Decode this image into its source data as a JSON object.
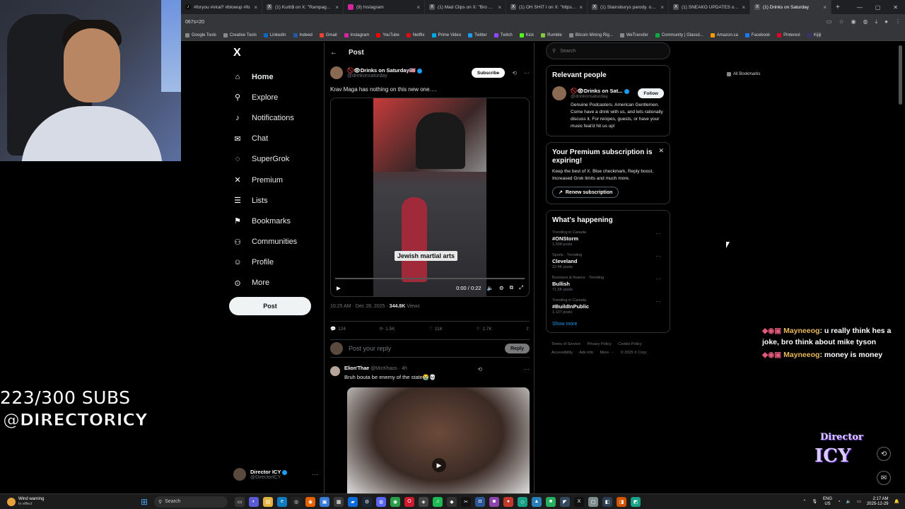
{
  "browser": {
    "tabs": [
      {
        "title": "#foryou #viral? #blowup #fo",
        "icon": "tiktok-icon",
        "active": false
      },
      {
        "title": "(1) Kurb$ on X: \"Rampage Ja",
        "icon": "x-logo-icon",
        "active": false
      },
      {
        "title": "(9) Instagram",
        "icon": "instagram-icon",
        "active": false
      },
      {
        "title": "(1) Mad Clips on X: \"Bro attac",
        "icon": "x-logo-icon",
        "active": false
      },
      {
        "title": "(1) OH SHIT I on X: \"https://t",
        "icon": "x-logo-icon",
        "active": false
      },
      {
        "title": "(1) Stainsburys parody. on X",
        "icon": "x-logo-icon",
        "active": false
      },
      {
        "title": "(1) SNEAKO UPDATES on X: \"",
        "icon": "x-logo-icon",
        "active": false
      },
      {
        "title": "(1) Drinks on Saturday",
        "icon": "x-logo-icon",
        "active": true
      }
    ],
    "address_value": "067s=20",
    "bookmarks": [
      "Google Tools",
      "Creative Tools",
      "LinkedIn",
      "Indeed",
      "Gmail",
      "Instagram",
      "YouTube",
      "Netflix",
      "Prime Video",
      "Twitter",
      "Twitch",
      "Kick",
      "Rumble",
      "Bitcoin Mining Rig...",
      "WeTransfer",
      "Community | Glassd...",
      "Amazon.ca",
      "Facebook",
      "Pinterest",
      "Kijiji"
    ],
    "all_bookmarks": "All Bookmarks"
  },
  "overlay": {
    "subs": "223/300 SUBS",
    "handle": "@DIRECTORICY",
    "chat": [
      {
        "user": "Mayneeog",
        "text": ": u really think hes a joke, bro think about mike tyson"
      },
      {
        "user": "Mayneeog",
        "text": ": money is money"
      }
    ],
    "logo_line1": "Director",
    "logo_line2": "ICY"
  },
  "sidebar": {
    "logo": "X",
    "items": [
      {
        "label": "Home",
        "icon": "home-icon",
        "glyph": "⌂"
      },
      {
        "label": "Explore",
        "icon": "search-icon",
        "glyph": "⚲"
      },
      {
        "label": "Notifications",
        "icon": "bell-icon",
        "glyph": "🔔"
      },
      {
        "label": "Chat",
        "icon": "mail-icon",
        "glyph": "✉"
      },
      {
        "label": "SuperGrok",
        "icon": "grok-icon",
        "glyph": "◌"
      },
      {
        "label": "Premium",
        "icon": "x-premium-icon",
        "glyph": "✕"
      },
      {
        "label": "Lists",
        "icon": "list-icon",
        "glyph": "☰"
      },
      {
        "label": "Bookmarks",
        "icon": "bookmark-icon",
        "glyph": "⚑"
      },
      {
        "label": "Communities",
        "icon": "people-icon",
        "glyph": "⚇"
      },
      {
        "label": "Profile",
        "icon": "person-icon",
        "glyph": "☺"
      },
      {
        "label": "More",
        "icon": "more-circle-icon",
        "glyph": "⊙"
      }
    ],
    "post_button": "Post",
    "account": {
      "name": "Director ICY",
      "handle": "@DirectorICY"
    }
  },
  "main": {
    "header": "Post",
    "author": {
      "name": "🚫👁Drinks on Saturday🇺🇸",
      "handle": "@drinkonsaturday"
    },
    "subscribe": "Subscribe",
    "text": "Krav Maga has nothing on this new one….",
    "video": {
      "caption": "Jewish martial arts",
      "time": "0:00 / 0:22",
      "progress": 0
    },
    "meta": {
      "time": "10:25 AM · Dec 28, 2025 · ",
      "views_count": "344.8K",
      "views_label": " Views"
    },
    "actions": {
      "replies": "124",
      "reposts": "1.5K",
      "likes": "11K",
      "bookmarks": "2.7K"
    },
    "reply_placeholder": "Post your reply",
    "reply_button": "Reply",
    "reply": {
      "name": "Elion'Thae",
      "handle": "@MicKhaos · 4h",
      "text": "Bruh bouta be enemy of the state😭💀"
    }
  },
  "right": {
    "search_placeholder": "Search",
    "relevant": {
      "title": "Relevant people",
      "name": "🚫👁Drinks on Sat...",
      "handle": "@drinkonsaturday",
      "follow": "Follow",
      "bio": "Genuine Podcasters. American Gentlemen. Come have a drink with us, and lets rationally discuss it. For recipes, guests, or have your music feat'd hit us up!"
    },
    "premium": {
      "title": "Your Premium subscription is expiring!",
      "text": "Keep the best of X. Blue checkmark, Reply boost, Increased Grok limits and much more.",
      "button": "Renew subscription"
    },
    "happening": {
      "title": "What's happening",
      "trends": [
        {
          "context": "Trending in Canada",
          "topic": "#ONStorm",
          "count": "1,598 posts"
        },
        {
          "context": "Sports · Trending",
          "topic": "Cleveland",
          "count": "22.4K posts"
        },
        {
          "context": "Business & finance · Trending",
          "topic": "Bullish",
          "count": "71.5K posts"
        },
        {
          "context": "Trending in Canada",
          "topic": "#BuildInPublic",
          "count": "1,137 posts"
        }
      ],
      "show_more": "Show more"
    },
    "footer": [
      "Terms of Service",
      "Privacy Policy",
      "Cookie Policy",
      "Accessibility",
      "Ads info",
      "More ···",
      "© 2025 X Corp."
    ]
  },
  "taskbar": {
    "weather_title": "Wind warning",
    "weather_sub": "In effect",
    "search": "Search",
    "lang1": "ENG",
    "lang2": "US",
    "time": "2:17 AM",
    "date": "2025-12-29"
  }
}
